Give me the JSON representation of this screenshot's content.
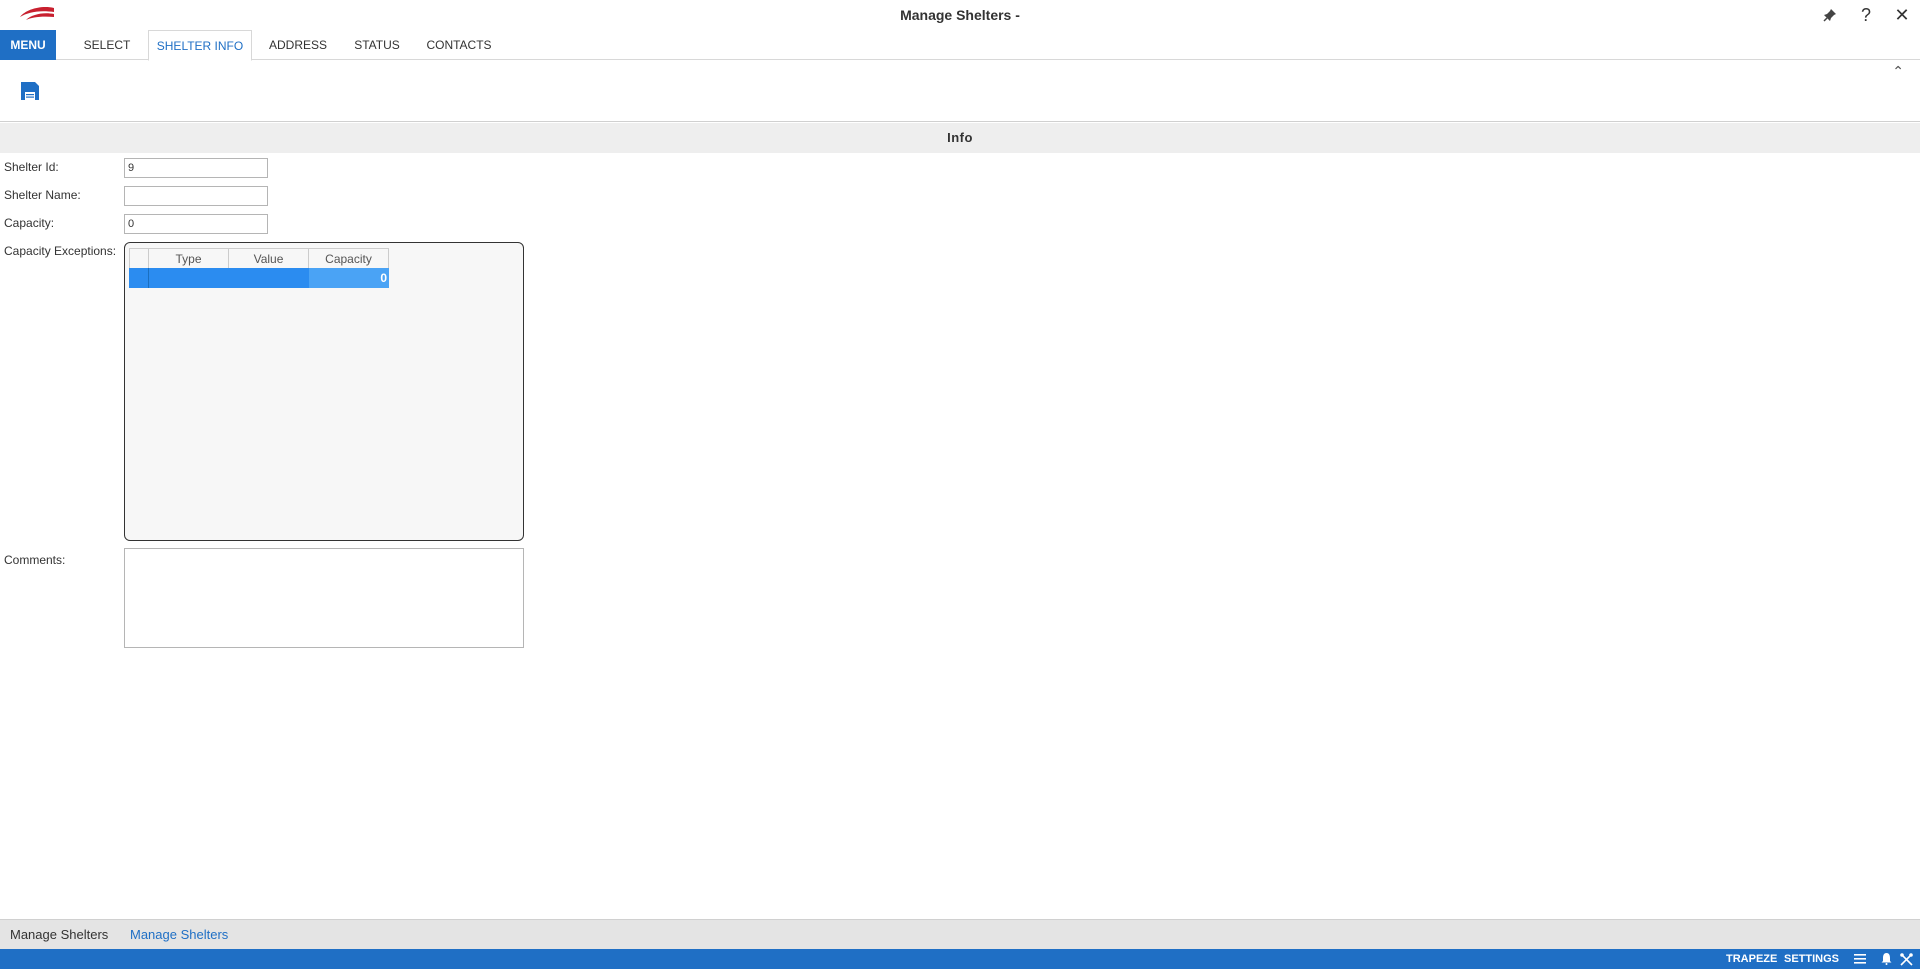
{
  "window": {
    "title": "Manage Shelters -",
    "icons": [
      "pin-icon",
      "help-icon",
      "close-icon"
    ],
    "help_glyph": "?",
    "close_glyph": "✕"
  },
  "menu_label": "MENU",
  "tabs": [
    {
      "label": "SELECT",
      "active": false
    },
    {
      "label": "SHELTER INFO",
      "active": true
    },
    {
      "label": "ADDRESS",
      "active": false
    },
    {
      "label": "STATUS",
      "active": false
    },
    {
      "label": "CONTACTS",
      "active": false
    }
  ],
  "toolbar": {
    "save_icon": "save-icon",
    "collapse_glyph": "⌃"
  },
  "section": {
    "title": "Info"
  },
  "form": {
    "shelter_id_label": "Shelter Id:",
    "shelter_id_value": "9",
    "shelter_name_label": "Shelter Name:",
    "shelter_name_value": "",
    "capacity_label": "Capacity:",
    "capacity_value": "0",
    "exceptions_label": "Capacity Exceptions:",
    "comments_label": "Comments:",
    "comments_value": ""
  },
  "exceptions_grid": {
    "columns": [
      "Type",
      "Value",
      "Capacity"
    ],
    "rows": [
      {
        "type": "",
        "value": "",
        "capacity": "0",
        "selected": true
      }
    ]
  },
  "bottom_tabs": [
    {
      "label": "Manage Shelters",
      "active": false
    },
    {
      "label": "Manage Shelters",
      "active": true
    }
  ],
  "statusbar": {
    "trapeze_label": "TRAPEZE",
    "settings_label": "SETTINGS",
    "icons": [
      "list-icon",
      "bell-icon",
      "tools-icon"
    ]
  },
  "colors": {
    "accent": "#1f6fc5",
    "selected_row": "#2b8cf0",
    "selected_cell": "#4aa3f5",
    "logo_red": "#c8202f"
  }
}
